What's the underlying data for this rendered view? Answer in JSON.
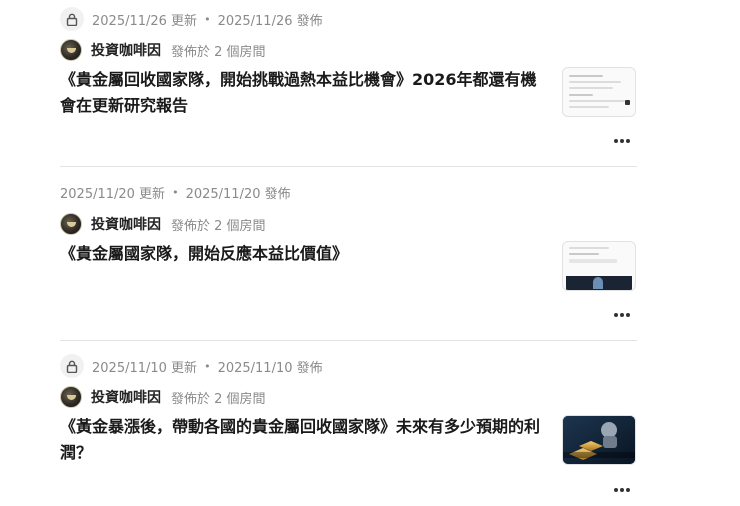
{
  "posts": [
    {
      "updated": "2025/11/26 更新",
      "published": "2025/11/26 發佈",
      "locked": true,
      "author": "投資咖啡因",
      "posted_in": "發佈於 2 個房間",
      "title": "《貴金屬回收國家隊，開始挑戰過熱本益比機會》2026年都還有機會在更新研究報告",
      "thumbnail": "document-screenshot"
    },
    {
      "updated": "2025/11/20 更新",
      "published": "2025/11/20 發佈",
      "locked": false,
      "author": "投資咖啡因",
      "posted_in": "發佈於 2 個房間",
      "title": "《貴金屬國家隊，開始反應本益比價值》",
      "thumbnail": "document-screenshot-with-image"
    },
    {
      "updated": "2025/11/10 更新",
      "published": "2025/11/10 發佈",
      "locked": true,
      "author": "投資咖啡因",
      "posted_in": "發佈於 2 個房間",
      "title": "《黃金暴漲後，帶動各國的貴金屬回收國家隊》未來有多少預期的利潤？",
      "thumbnail": "gold-bars-robot-image"
    }
  ],
  "separator": "•",
  "icons": {
    "lock": "lock-icon",
    "more": "more-options-icon"
  },
  "colors": {
    "meta_text": "#8a8a8a",
    "title_text": "#1a1a1a",
    "divider": "#e3e3e3"
  }
}
